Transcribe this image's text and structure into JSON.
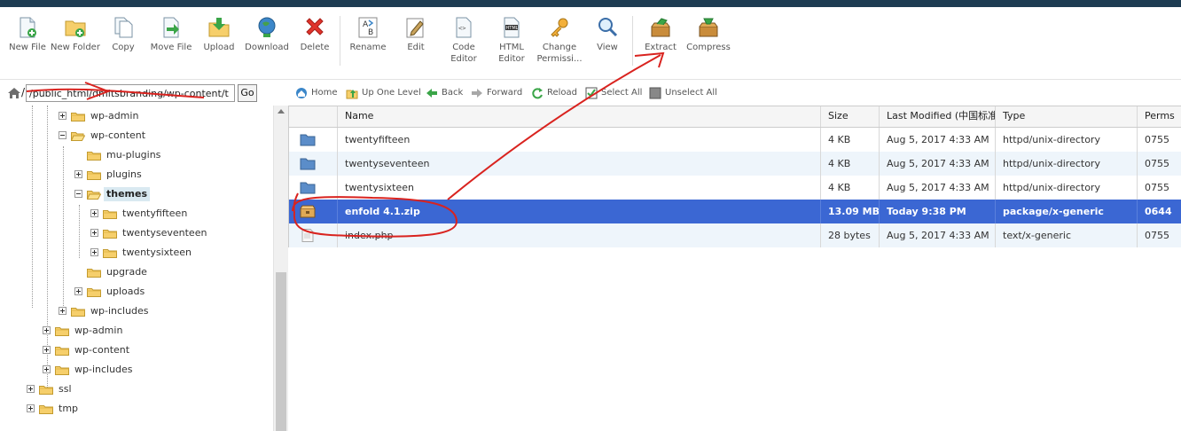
{
  "toolbar": {
    "buttons": [
      {
        "label": "New File",
        "icon": "new-file-icon"
      },
      {
        "label": "New Folder",
        "icon": "new-folder-icon"
      },
      {
        "label": "Copy",
        "icon": "copy-icon"
      },
      {
        "label": "Move File",
        "icon": "move-file-icon"
      },
      {
        "label": "Upload",
        "icon": "upload-icon"
      },
      {
        "label": "Download",
        "icon": "download-icon"
      },
      {
        "label": "Delete",
        "icon": "delete-icon"
      },
      {
        "label": "Rename",
        "icon": "rename-icon"
      },
      {
        "label": "Edit",
        "icon": "edit-icon"
      },
      {
        "label": "Code Editor",
        "icon": "code-editor-icon"
      },
      {
        "label": "HTML Editor",
        "icon": "html-editor-icon"
      },
      {
        "label": "Change Permissi...",
        "icon": "key-icon"
      },
      {
        "label": "View",
        "icon": "magnifier-icon"
      },
      {
        "label": "Extract",
        "icon": "extract-icon"
      },
      {
        "label": "Compress",
        "icon": "compress-icon"
      }
    ]
  },
  "path": {
    "value": "/public_html/dmitsbranding/wp-content/t",
    "go_label": "Go"
  },
  "tree": {
    "nodes": [
      {
        "label": "wp-admin"
      },
      {
        "label": "wp-content"
      },
      {
        "label": "mu-plugins"
      },
      {
        "label": "plugins"
      },
      {
        "label": "themes"
      },
      {
        "label": "twentyfifteen"
      },
      {
        "label": "twentyseventeen"
      },
      {
        "label": "twentysixteen"
      },
      {
        "label": "upgrade"
      },
      {
        "label": "uploads"
      },
      {
        "label": "wp-includes"
      },
      {
        "label": "wp-admin"
      },
      {
        "label": "wp-content"
      },
      {
        "label": "wp-includes"
      },
      {
        "label": "ssl"
      },
      {
        "label": "tmp"
      }
    ]
  },
  "nav": {
    "home": "Home",
    "up": "Up One Level",
    "back": "Back",
    "forward": "Forward",
    "reload": "Reload",
    "select_all": "Select All",
    "unselect_all": "Unselect All"
  },
  "table": {
    "columns": {
      "name": "Name",
      "size": "Size",
      "modified": "Last Modified (中国标准时间)",
      "type": "Type",
      "perms": "Perms"
    },
    "rows": [
      {
        "name": "twentyfifteen",
        "size": "4 KB",
        "modified": "Aug 5, 2017 4:33 AM",
        "type": "httpd/unix-directory",
        "perms": "0755"
      },
      {
        "name": "twentyseventeen",
        "size": "4 KB",
        "modified": "Aug 5, 2017 4:33 AM",
        "type": "httpd/unix-directory",
        "perms": "0755"
      },
      {
        "name": "twentysixteen",
        "size": "4 KB",
        "modified": "Aug 5, 2017 4:33 AM",
        "type": "httpd/unix-directory",
        "perms": "0755"
      },
      {
        "name": "enfold 4.1.zip",
        "size": "13.09 MB",
        "modified": "Today 9:38 PM",
        "type": "package/x-generic",
        "perms": "0644"
      },
      {
        "name": "index.php",
        "size": "28 bytes",
        "modified": "Aug 5, 2017 4:33 AM",
        "type": "text/x-generic",
        "perms": "0755"
      }
    ]
  },
  "colors": {
    "topbar": "#1e3c52",
    "selection": "#3b67d3",
    "annotation": "#d9231f",
    "folder": "#f0c15a"
  }
}
